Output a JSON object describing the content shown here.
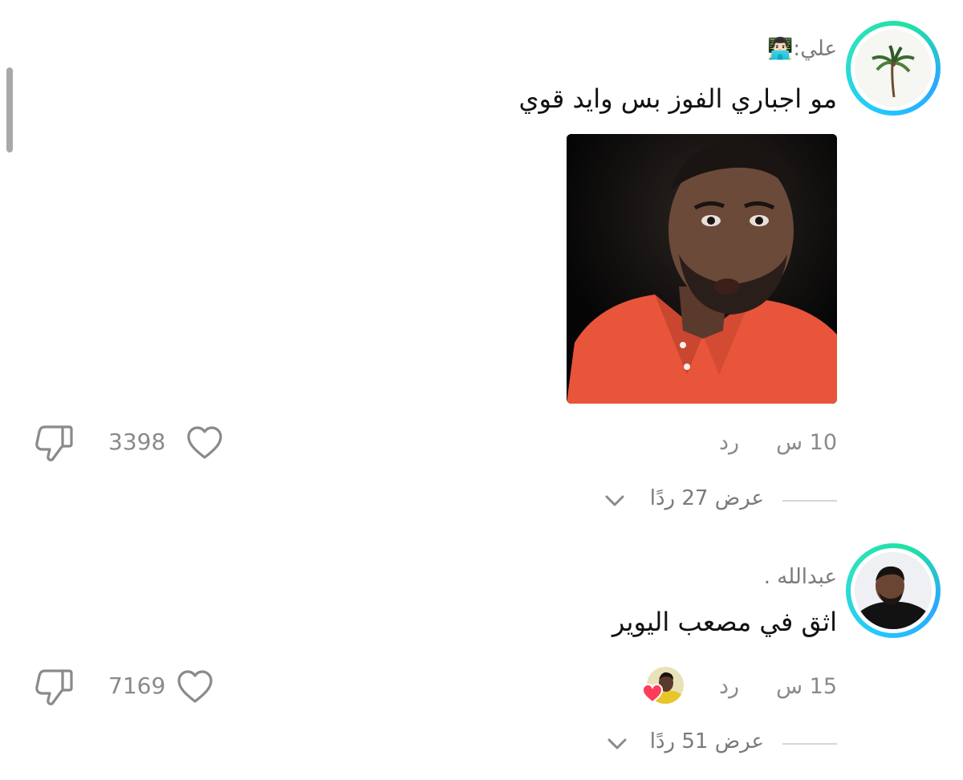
{
  "comments": [
    {
      "username": "علي:👨🏻‍💻",
      "text": "مو اجباري الفوز بس وايد قوي",
      "time": "10 س",
      "reply_label": "رد",
      "likes": "3398",
      "view_replies": "عرض 27 ردًا",
      "has_media": true
    },
    {
      "username": "عبدالله .",
      "text": "اثق في مصعب اليوير",
      "time": "15 س",
      "reply_label": "رد",
      "likes": "7169",
      "view_replies": "عرض 51 ردًا",
      "has_creator_like": true
    }
  ],
  "colors": {
    "ring_gradient": [
      "#22c8ff",
      "#1ee3a0"
    ],
    "text_primary": "#111111",
    "text_secondary": "#8a8a8a",
    "heart_liked": "#ff3b5c"
  },
  "icons": {
    "like": "heart-outline-icon",
    "dislike": "thumbs-down-icon",
    "expand": "chevron-down-icon"
  }
}
